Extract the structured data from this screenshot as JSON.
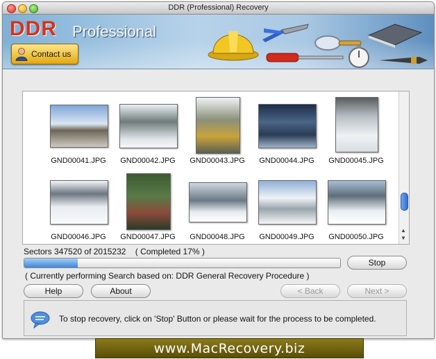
{
  "window": {
    "title": "DDR (Professional) Recovery"
  },
  "banner": {
    "brand": "DDR",
    "edition": "Professional",
    "contact_label": "Contact us"
  },
  "files": [
    {
      "name": "GND00041.JPG"
    },
    {
      "name": "GND00042.JPG"
    },
    {
      "name": "GND00043.JPG"
    },
    {
      "name": "GND00044.JPG"
    },
    {
      "name": "GND00045.JPG"
    },
    {
      "name": "GND00046.JPG"
    },
    {
      "name": "GND00047.JPG"
    },
    {
      "name": "GND00048.JPG"
    },
    {
      "name": "GND00049.JPG"
    },
    {
      "name": "GND00050.JPG"
    }
  ],
  "progress": {
    "sectors_text": "Sectors 347520 of 2015232",
    "completed_text": "( Completed 17% )",
    "percent": 17,
    "stop_label": "Stop",
    "status_text": "( Currently performing Search based on: DDR General Recovery Procedure )"
  },
  "nav": {
    "help": "Help",
    "about": "About",
    "back": "< Back",
    "next": "Next >"
  },
  "hint": {
    "text": "To stop recovery, click on 'Stop' Button or please wait for the process to be completed."
  },
  "footer": {
    "url": "www.MacRecovery.biz"
  },
  "colors": {
    "brand_red": "#d6321d",
    "progress_fill": "#3f87da",
    "footer_bg": "#6e6212"
  }
}
